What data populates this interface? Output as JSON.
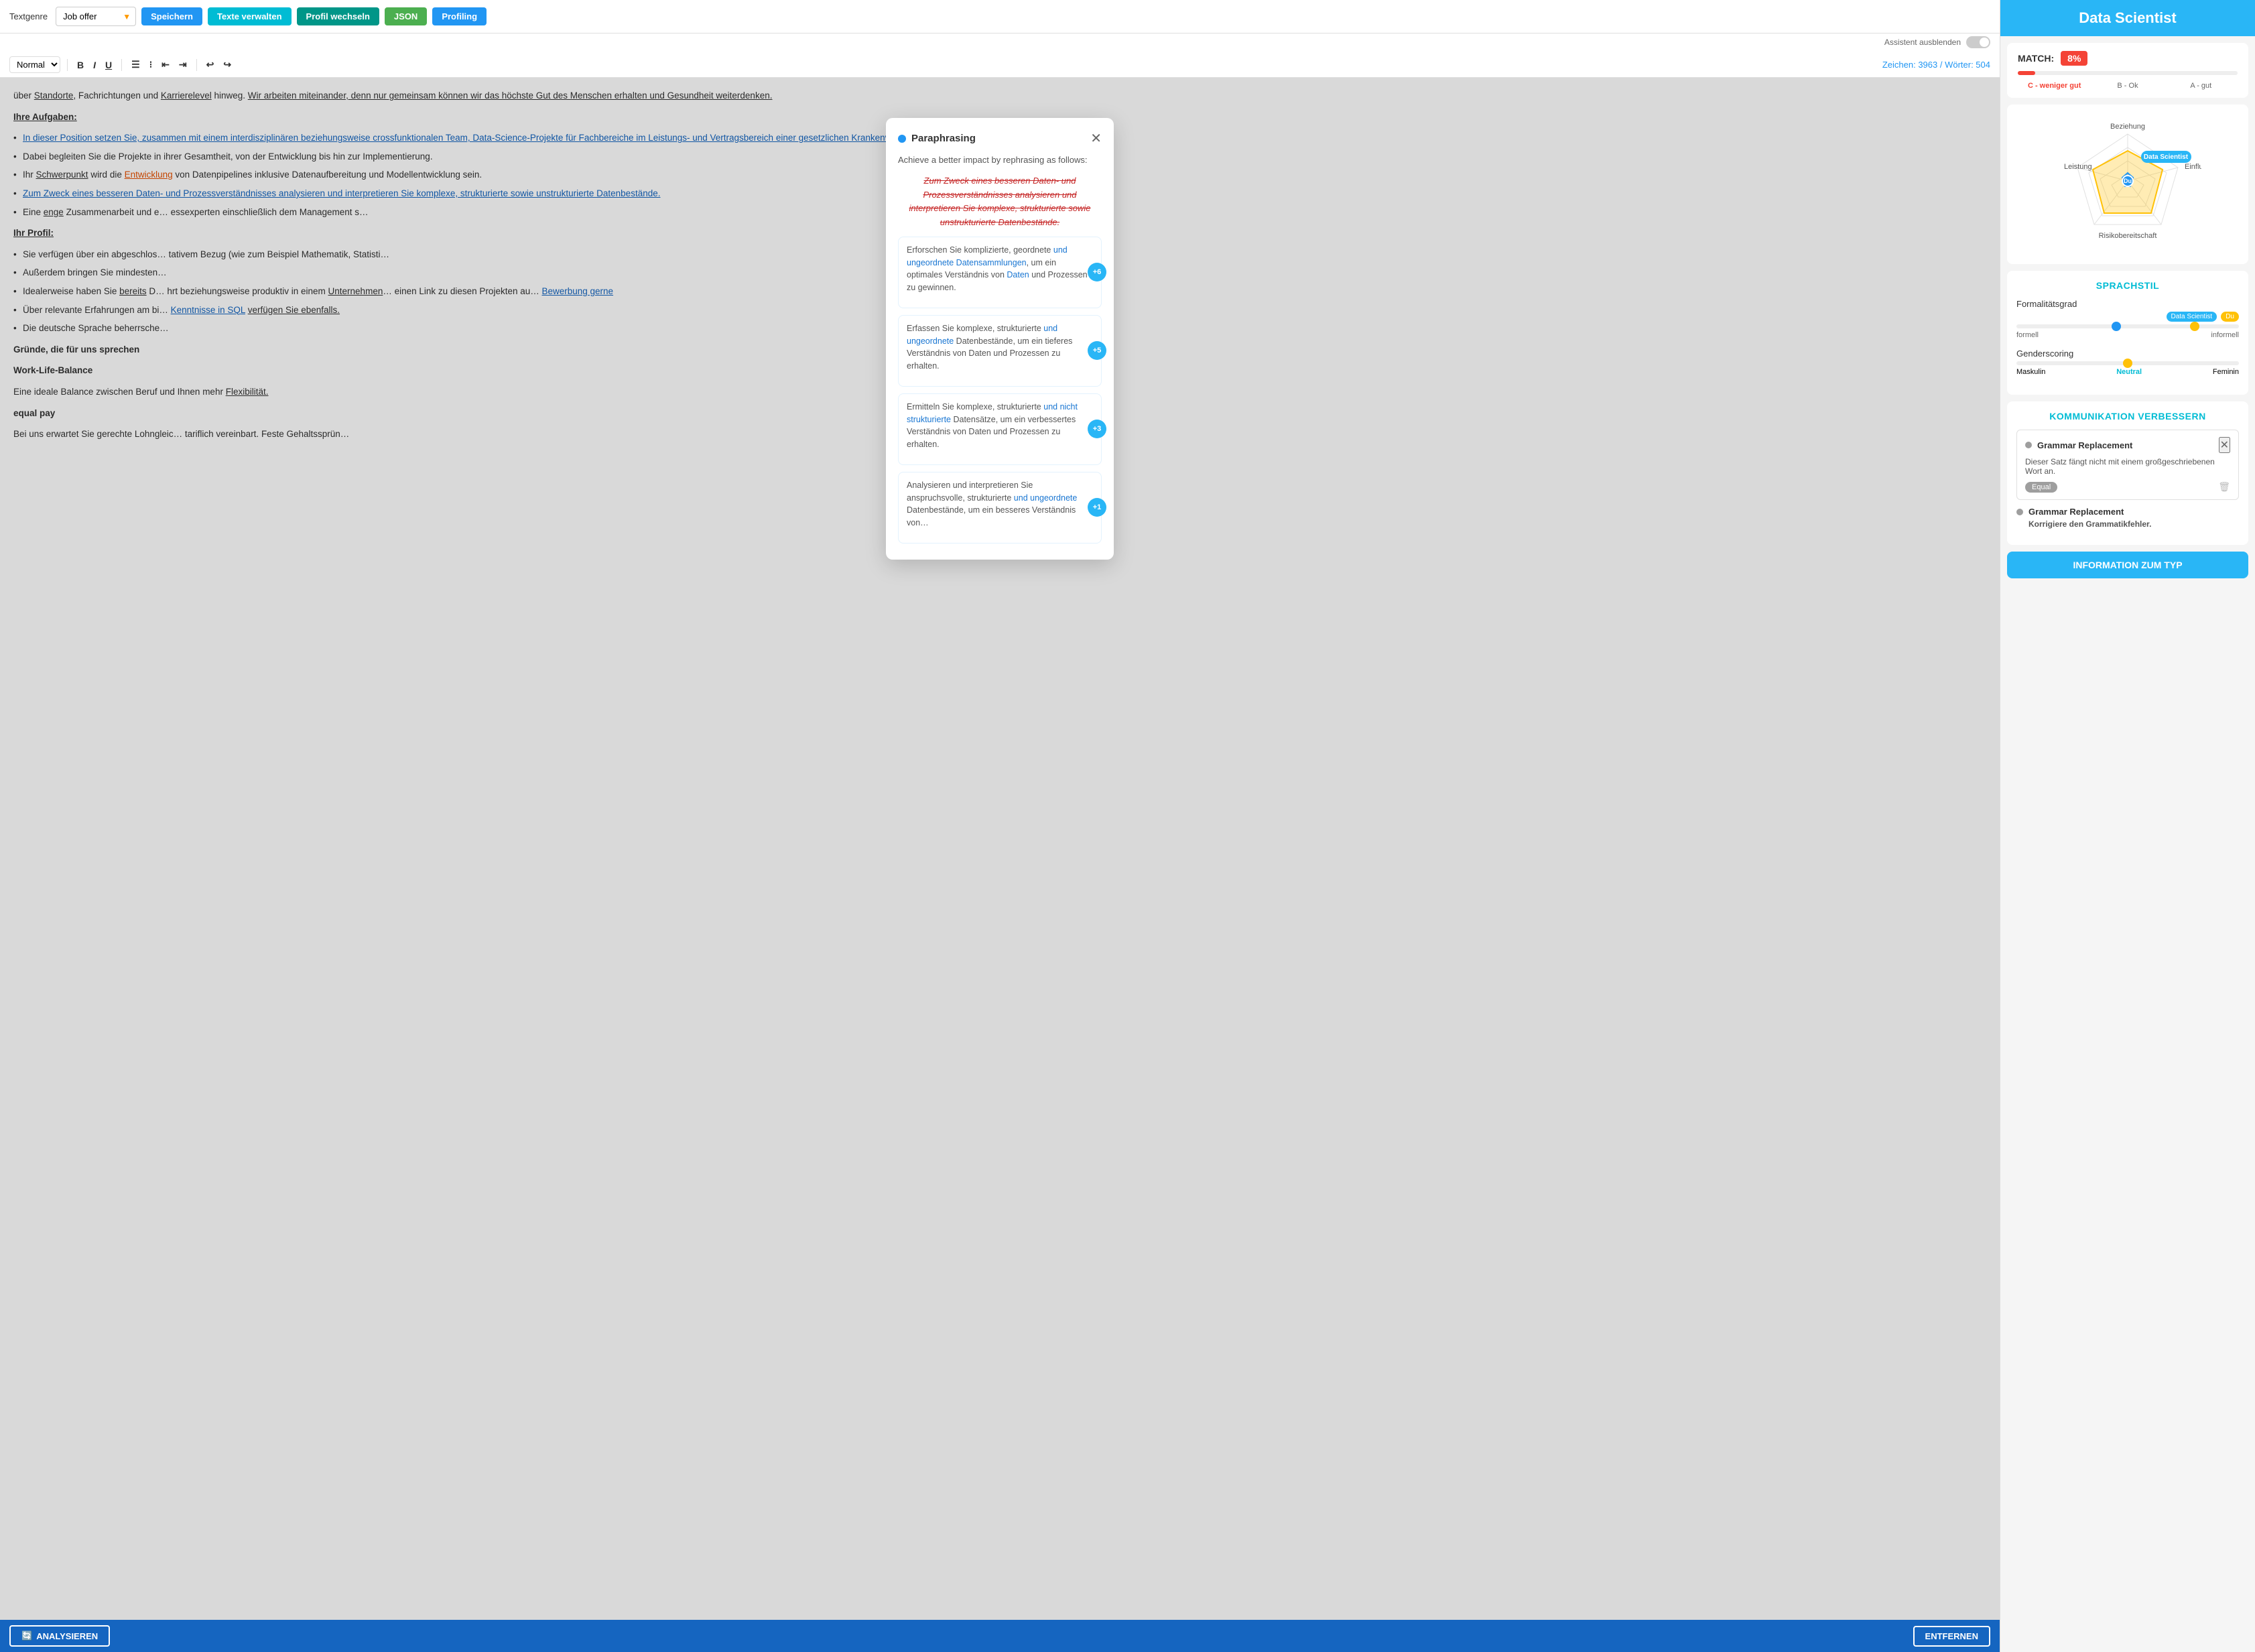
{
  "toolbar": {
    "genre_label": "Textgenre",
    "genre_value": "Job offer",
    "btn_save": "Speichern",
    "btn_manage": "Texte verwalten",
    "btn_profile": "Profil wechseln",
    "btn_json": "JSON",
    "btn_profiling": "Profiling",
    "toggle_label": "Assistent ausblenden"
  },
  "format_bar": {
    "style_value": "Normal",
    "char_count": "Zeichen: 3963 / Wörter: 504"
  },
  "editor": {
    "paragraph1": "über Standorte, Fachrichtungen und Karrierelevel hinweg. Wir arbeiten miteinander, denn nur gemeinsam können wir das höchste Gut des Menschen erhalten und Gesundheit weiterdenken.",
    "section_aufgaben": "Ihre Aufgaben:",
    "bullet1": "In dieser Position setzen Sie, zusammen mit einem interdisziplinären beziehungsweise crossfunktionalen Team, Data-Science-Projekte für Fachbereiche im Leistungs- und Vertragsbereich einer gesetzlichen Krankenversicherung um.",
    "bullet2": "Dabei begleiten Sie die Projekte in ihrer Gesamtheit, von der Entwicklung bis hin zur Implementierung.",
    "bullet3": "Ihr Schwerpunkt wird die Entwicklung von Datenpipelines inklusive Datenaufbereitung und Modellentwicklung sein.",
    "bullet4": "Zum Zweck eines besseren Daten- und Prozessverständnisses analysieren und interpretieren Sie komplexe, strukturierte sowie unstrukturierte Datenbestände.",
    "bullet5_partial": "Eine enge Zusammenarbeit und e",
    "bullet5_end": "essexperten einschließlich dem Management s",
    "section_profil": "Ihr Profil:",
    "profil1_partial": "Sie verfügen über ein abgeschlos",
    "profil1_end": "tativem Bezug (wie zum Beispiel Mathematik, Statisti",
    "profil2_partial": "Außerdem bringen Sie mindesten",
    "profil3_partial": "Idealerweise haben Sie bereits D",
    "profil3_end": "hrt beziehungsweise produktiv in einem Unternehmen",
    "profil3_end2": "einen Link zu diesen Projekten au",
    "profil3_bewerbung": "Bewerbung gerne",
    "profil4_partial": "Über relevante Erfahrungen am bi",
    "profil4_end": "Kenntnisse in SQL verfügen Sie ebenfalls.",
    "profil5_partial": "Die deutsche Sprache beherrsche",
    "section_gruende": "Gründe, die für uns sprechen",
    "subsection1": "Work-Life-Balance",
    "wlb_text": "Eine ideale Balance zwischen Beruf und",
    "wlb_text2": "Ihnen mehr Flexibilität.",
    "subsection2": "equal pay",
    "equal_text": "Bei uns erwartet Sie gerechte Lohngleic",
    "equal_text2": "tariflich vereinbart. Feste Gehaltssprün"
  },
  "bottom_bar": {
    "btn_analyse": "ANALYSIEREN",
    "btn_remove": "ENTFERNEN"
  },
  "right_panel": {
    "title": "Data Scientist",
    "match_label": "MATCH:",
    "match_value": "8%",
    "grade_c": "C - weniger gut",
    "grade_b": "B - Ok",
    "grade_a": "A - gut",
    "radar": {
      "label_beziehung": "Beziehung",
      "label_einfluss": "Einfluss",
      "label_risiko": "Risikobereitschaft",
      "label_leistung": "Leistung",
      "label_ds": "Data Scientist",
      "label_du": "Du"
    },
    "sprachstil": {
      "title": "SPRACHSTIL",
      "formalitaet_label": "Formalitätsgrad",
      "badge_ds": "Data Scientist",
      "badge_du": "Du",
      "label_formell": "formell",
      "label_informell": "informell",
      "gender_label": "Genderscoring",
      "label_maskulin": "Maskulin",
      "label_neutral": "Neutral",
      "label_feminin": "Feminin"
    },
    "kommunikation": {
      "title": "KOMMUNIKATION VERBESSERN",
      "item1_title": "Grammar Replacement",
      "item1_desc": "Dieser Satz fängt nicht mit einem großgeschriebenen Wort an.",
      "item1_badge": "Equal",
      "item2_title": "Grammar Replacement",
      "item2_desc": "Korrigiere den Grammatikfehler."
    },
    "info_section": "INFORMATION ZUM TYP"
  },
  "modal": {
    "title": "Paraphrasing",
    "subtitle": "Achieve a better impact by rephrasing as follows:",
    "original": "Zum Zweck eines besseren Daten- und Prozessverständnisses analysieren und interpretieren Sie komplexe, strukturierte sowie unstrukturierte Datenbestände.",
    "options": [
      {
        "id": 1,
        "score": "+6",
        "text_before": "Erforschen Sie komplizierte, geordnete",
        "text_highlight": " und ungeordnete Datensammlungen",
        "text_after": ", um ein optimales Verständnis von",
        "text_highlight2": " Daten",
        "text_after2": " und Prozessen zu gewinnen."
      },
      {
        "id": 2,
        "score": "+5",
        "text_before": "Erfassen Sie komplexe, strukturierte",
        "text_highlight": " und ungeordnete",
        "text_after": " Datenbestände, um ein tieferes Verständnis von Daten und Prozessen zu erhalten."
      },
      {
        "id": 3,
        "score": "+3",
        "text_before": "Ermitteln Sie komplexe, strukturierte",
        "text_highlight": " und nicht strukturierte",
        "text_after": " Datensätze, um ein verbessertes Verständnis von Daten und Prozessen zu erhalten."
      },
      {
        "id": 4,
        "score": "+1",
        "text_before": "Analysieren und interpretieren Sie anspruchsvolle, strukturierte",
        "text_highlight": " und ungeordnete",
        "text_after": " Datenbestände, um ein besseres Verständnis von"
      }
    ]
  }
}
